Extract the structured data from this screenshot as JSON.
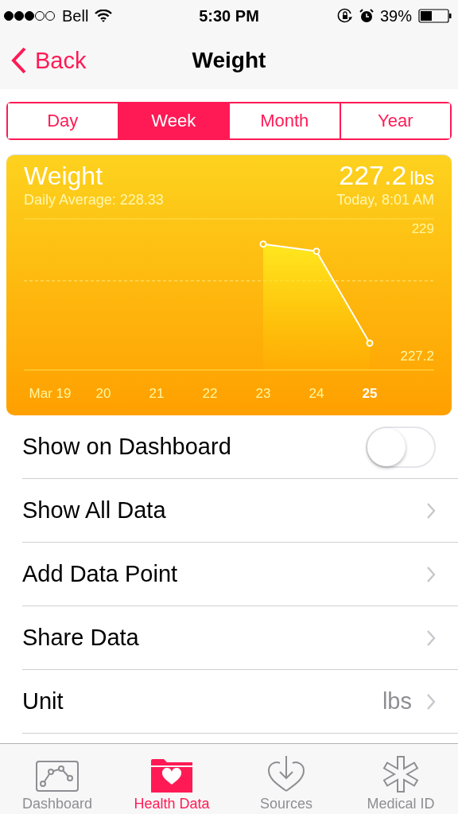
{
  "status_bar": {
    "carrier": "Bell",
    "time": "5:30 PM",
    "battery": "39%"
  },
  "nav_bar": {
    "back": "Back",
    "title": "Weight"
  },
  "segments": [
    {
      "label": "Day",
      "selected": false
    },
    {
      "label": "Week",
      "selected": true
    },
    {
      "label": "Month",
      "selected": false
    },
    {
      "label": "Year",
      "selected": false
    }
  ],
  "card": {
    "title": "Weight",
    "value": "227.2",
    "unit": "lbs",
    "subtitle": "Daily Average: 228.33",
    "timestamp": "Today, 8:01 AM",
    "today_marked": true,
    "chart_data": {
      "type": "area",
      "categories": [
        "Mar 19",
        "20",
        "21",
        "22",
        "23",
        "24",
        "25"
      ],
      "series": [
        {
          "color": "#ffffff",
          "values": [
            null,
            null,
            null,
            null,
            228.8,
            228.7,
            227.4
          ]
        }
      ],
      "ylim": [
        227.2,
        229
      ],
      "yticks": [
        227.2,
        229
      ]
    }
  },
  "rows": [
    {
      "kind": "toggle",
      "label": "Show on Dashboard",
      "on": false
    },
    {
      "kind": "link",
      "label": "Show All Data"
    },
    {
      "kind": "link",
      "label": "Add Data Point"
    },
    {
      "kind": "link",
      "label": "Share Data"
    },
    {
      "kind": "link",
      "label": "Unit",
      "value": "lbs"
    }
  ],
  "tab_bar": [
    {
      "label": "Dashboard",
      "selected": false
    },
    {
      "label": "Health Data",
      "selected": true
    },
    {
      "label": "Sources",
      "selected": false
    },
    {
      "label": "Medical ID",
      "selected": false
    }
  ]
}
